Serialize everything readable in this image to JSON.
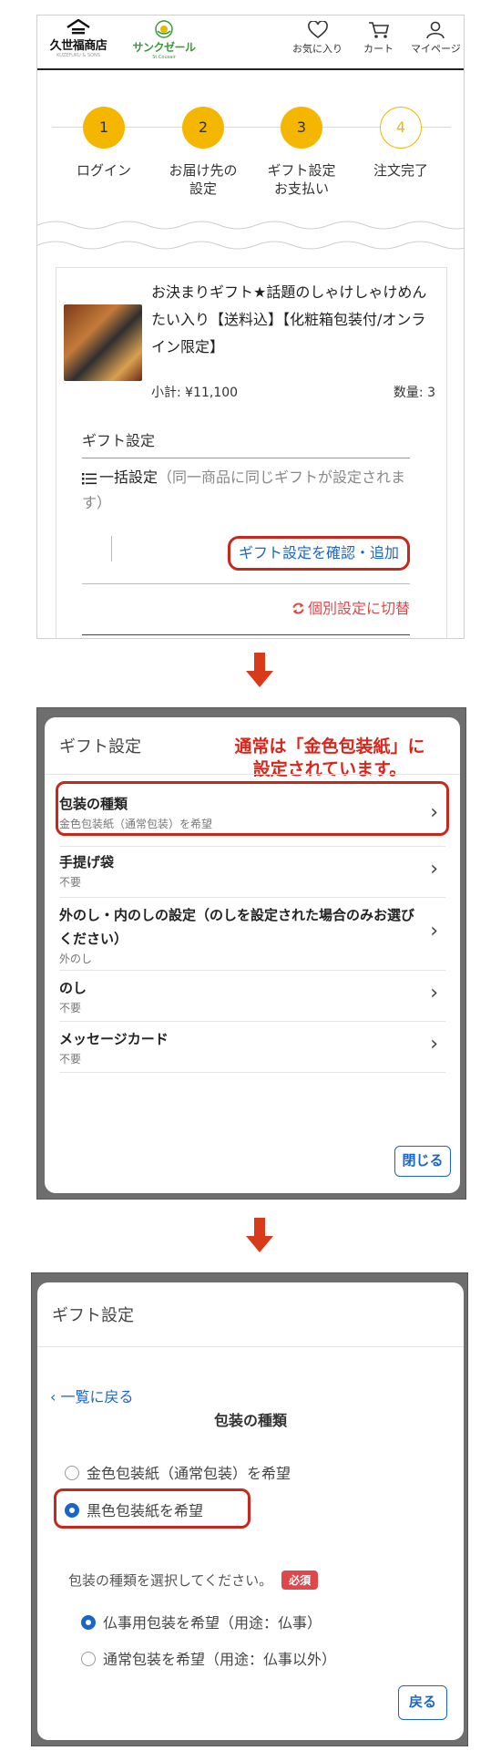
{
  "header": {
    "brand_kuze": "久世福商店",
    "brand_kuze_tagline": "KUZEFUKU & SONS",
    "brand_sun": "サンクゼール",
    "brand_sun_sub": "St.Cousair",
    "nav": [
      {
        "label": "お気に入り",
        "icon": "heart-icon"
      },
      {
        "label": "カート",
        "icon": "cart-icon"
      },
      {
        "label": "マイページ",
        "icon": "user-icon"
      }
    ]
  },
  "steps": [
    {
      "num": "1",
      "label": "ログイン",
      "done": true
    },
    {
      "num": "2",
      "label": "お届け先の\n設定",
      "done": true
    },
    {
      "num": "3",
      "label": "ギフト設定\nお支払い",
      "done": true
    },
    {
      "num": "4",
      "label": "注文完了",
      "done": false
    }
  ],
  "product": {
    "title": "お決まりギフト★話題のしゃけしゃけめんたい入り【送料込】【化粧箱包装付/オンライン限定】",
    "subtotal": "小計: ¥11,100",
    "quantity": "数量: 3"
  },
  "gift_section": {
    "heading": "ギフト設定",
    "bulk_label": "一括設定",
    "bulk_note": "（同一商品に同じギフトが設定されます）",
    "confirm_button": "ギフト設定を確認・追加",
    "switch_link": "個別設定に切替"
  },
  "modal_list": {
    "title": "ギフト設定",
    "callout": "通常は「金色包装紙」に\n設定されています。",
    "options": [
      {
        "name": "包装の種類",
        "value": "金色包装紙（通常包装）を希望"
      },
      {
        "name": "手提げ袋",
        "value": "不要"
      },
      {
        "name": "外のし・内のしの設定（のしを設定された場合のみお選びください）",
        "value": "外のし"
      },
      {
        "name": "のし",
        "value": "不要"
      },
      {
        "name": "メッセージカード",
        "value": "不要"
      }
    ],
    "close_button": "閉じる"
  },
  "modal_detail": {
    "title": "ギフト設定",
    "back_link": "一覧に戻る",
    "section_title": "包装の種類",
    "choices": [
      {
        "label": "金色包装紙（通常包装）を希望",
        "selected": false
      },
      {
        "label": "黒色包装紙を希望",
        "selected": true
      }
    ],
    "sub_prompt": "包装の種類を選択してください。",
    "required_badge": "必須",
    "sub_choices": [
      {
        "label": "仏事用包装を希望（用途：仏事）",
        "selected": true
      },
      {
        "label": "通常包装を希望（用途：仏事以外）",
        "selected": false
      }
    ],
    "back_button": "戻る"
  },
  "colors": {
    "accent_yellow": "#f5b600",
    "link_blue": "#1a66c8",
    "highlight_red": "#c8281b",
    "switch_red": "#e0474a",
    "overlay_gray": "#6e6e6e"
  }
}
